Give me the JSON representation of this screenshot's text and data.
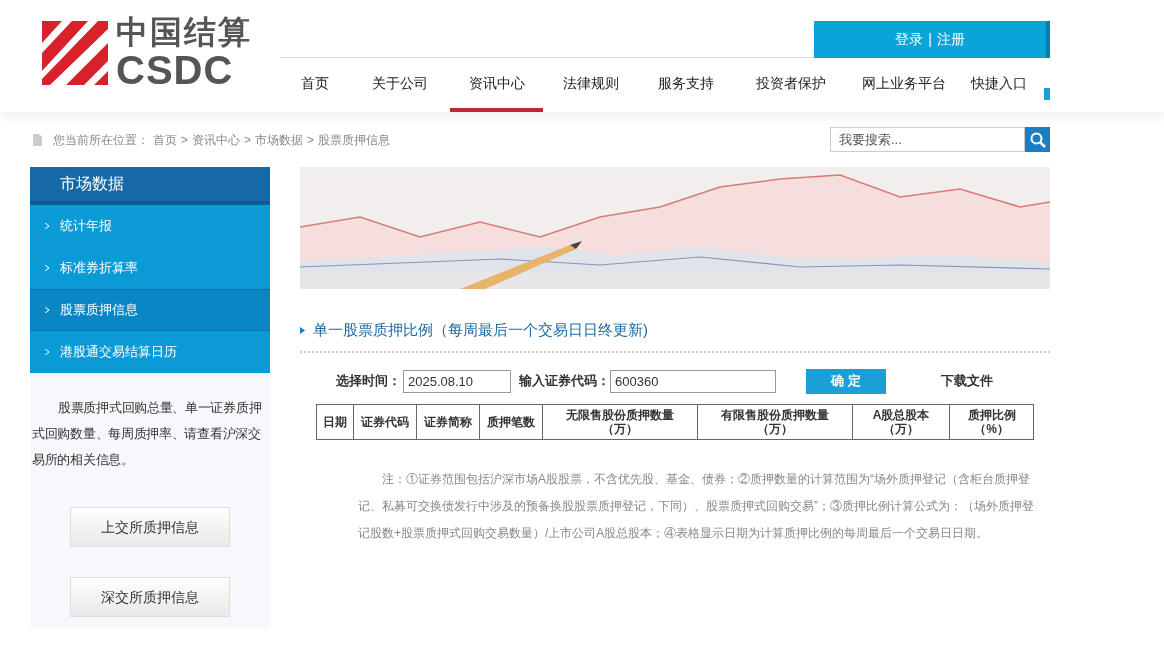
{
  "logo": {
    "chinese": "中国结算",
    "latin": "CSDC"
  },
  "login": {
    "login": "登录",
    "separator": "|",
    "register": "注册"
  },
  "nav": [
    {
      "label": "首页",
      "selected": false
    },
    {
      "label": "关于公司",
      "selected": false
    },
    {
      "label": "资讯中心",
      "selected": true
    },
    {
      "label": "法律规则",
      "selected": false
    },
    {
      "label": "服务支持",
      "selected": false
    },
    {
      "label": "投资者保护",
      "selected": false
    },
    {
      "label": "网上业务平台",
      "selected": false
    },
    {
      "label": "快捷入口",
      "selected": false
    }
  ],
  "breadcrumb": {
    "prefix": "您当前所在位置：",
    "items": [
      "首页",
      "资讯中心",
      "市场数据",
      "股票质押信息"
    ],
    "separator": ">"
  },
  "search": {
    "placeholder": "我要搜索..."
  },
  "sidebar": {
    "title": "市场数据",
    "items": [
      {
        "label": "统计年报",
        "selected": false
      },
      {
        "label": "标准券折算率",
        "selected": false
      },
      {
        "label": "股票质押信息",
        "selected": true
      },
      {
        "label": "港股通交易结算日历",
        "selected": false
      }
    ],
    "description": "股票质押式回购总量、单一证券质押式回购数量、每周质押率、请查看沪深交易所的相关信息。",
    "buttons": [
      "上交所质押信息",
      "深交所质押信息"
    ]
  },
  "section_title": "单一股票质押比例（每周最后一个交易日日终更新)",
  "form": {
    "date_label": "选择时间：",
    "date_value": "2025.08.10",
    "code_label": "输入证券代码：",
    "code_value": "600360",
    "submit": "确 定",
    "download": "下载文件"
  },
  "table": {
    "columns": [
      "日期",
      "证券代码",
      "证券简称",
      "质押笔数",
      "无限售股份质押数量（万）",
      "有限售股份质押数量（万）",
      "A股总股本（万）",
      "质押比例（%）"
    ]
  },
  "note": "注：①证券范围包括沪深市场A股股票，不含优先股、基金、债券；②质押数量的计算范围为“场外质押登记（含柜台质押登记、私募可交换债发行中涉及的预备换股股票质押登记，下同）、股票质押式回购交易”；③质押比例计算公式为：（场外质押登记股数+股票质押式回购交易数量）/上市公司A股总股本；④表格显示日期为计算质押比例的每周最后一个交易日日期。"
}
